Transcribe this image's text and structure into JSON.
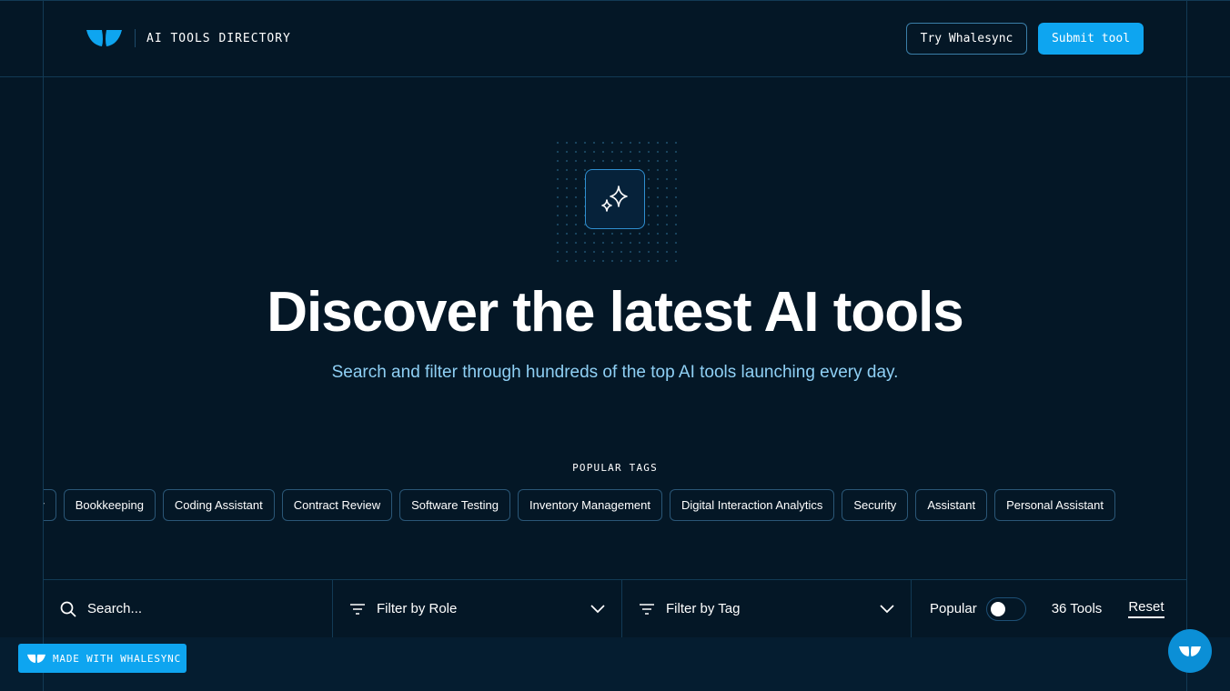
{
  "header": {
    "title": "AI TOOLS DIRECTORY",
    "try_label": "Try Whalesync",
    "submit_label": "Submit tool"
  },
  "hero": {
    "title": "Discover the latest AI tools",
    "subtitle": "Search and filter through hundreds of the top AI tools launching every day."
  },
  "tags": {
    "heading": "POPULAR TAGS",
    "items": [
      "Library",
      "Bookkeeping",
      "Coding Assistant",
      "Contract Review",
      "Software Testing",
      "Inventory Management",
      "Digital Interaction Analytics",
      "Security",
      "Assistant",
      "Personal Assistant"
    ]
  },
  "filters": {
    "search_placeholder": "Search...",
    "role_label": "Filter by Role",
    "tag_label": "Filter by Tag",
    "popular_label": "Popular",
    "popular_on": false,
    "count": "36 Tools",
    "reset_label": "Reset"
  },
  "footer": {
    "badge": "MADE WITH WHALESYNC"
  },
  "colors": {
    "accent": "#0ea5f0",
    "bg": "#041726"
  }
}
